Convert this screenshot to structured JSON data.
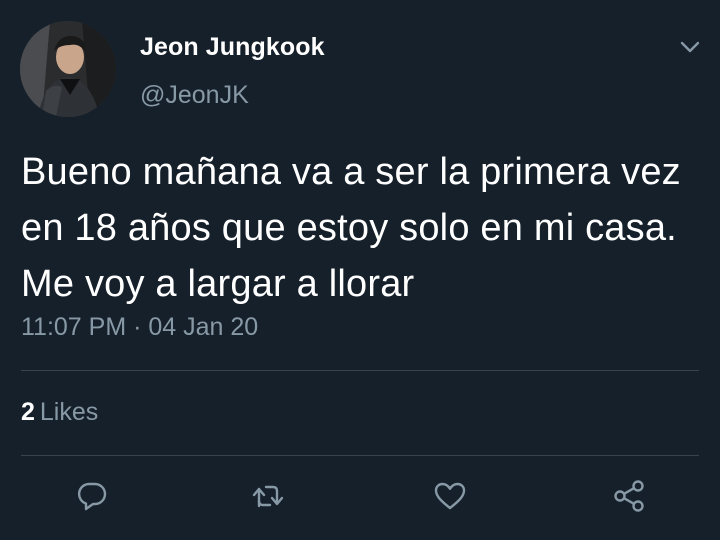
{
  "author": {
    "display_name": "Jeon Jungkook",
    "handle": "@JeonJK",
    "avatar_icon": "profile-photo"
  },
  "tweet": {
    "text": "Bueno mañana va a ser la primera vez en 18 años que estoy solo en mi casa. Me voy a largar a llorar",
    "timestamp": "11:07 PM · 04 Jan 20"
  },
  "stats": {
    "likes_count": "2",
    "likes_label": "Likes"
  },
  "actions": [
    {
      "icon": "reply-icon"
    },
    {
      "icon": "retweet-icon"
    },
    {
      "icon": "like-icon"
    },
    {
      "icon": "share-icon"
    }
  ],
  "colors": {
    "background": "#15202b",
    "text_primary": "#ffffff",
    "text_secondary": "#8899a6",
    "divider": "#38444d"
  }
}
